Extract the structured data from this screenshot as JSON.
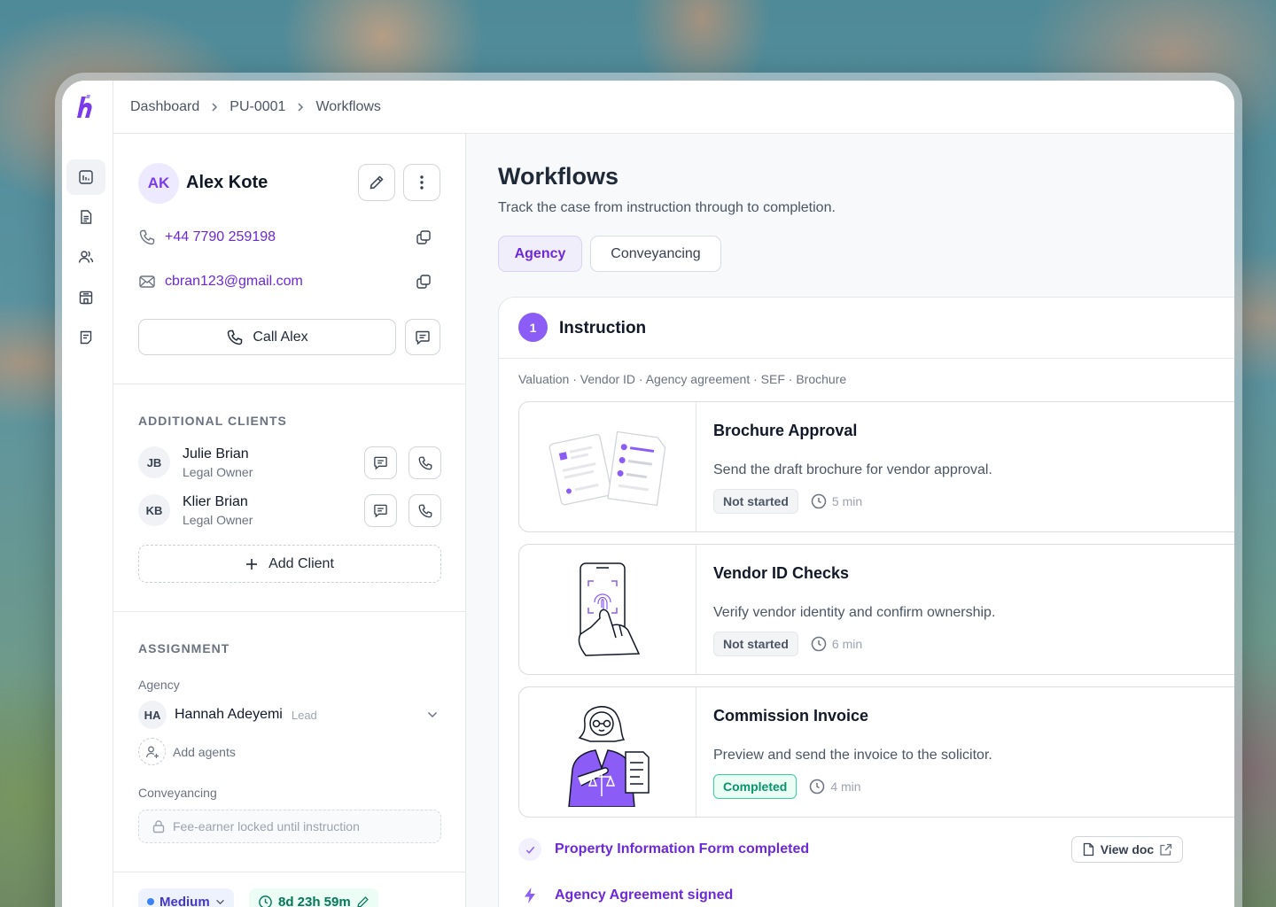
{
  "breadcrumb": [
    "Dashboard",
    "PU-0001",
    "Workflows"
  ],
  "nav": {
    "items": [
      {
        "icon": "reports-icon"
      },
      {
        "icon": "document-icon"
      },
      {
        "icon": "people-icon"
      },
      {
        "icon": "building-icon"
      },
      {
        "icon": "notes-icon"
      }
    ]
  },
  "client": {
    "initials": "AK",
    "name": "Alex Kote",
    "phone": "+44 7790 259198",
    "email": "cbran123@gmail.com",
    "call_label": "Call Alex"
  },
  "additional_clients": {
    "heading": "ADDITIONAL CLIENTS",
    "items": [
      {
        "initials": "JB",
        "name": "Julie Brian",
        "role": "Legal Owner"
      },
      {
        "initials": "KB",
        "name": "Klier Brian",
        "role": "Legal Owner"
      }
    ],
    "add_label": "Add Client"
  },
  "assignment": {
    "heading": "ASSIGNMENT",
    "agency_label": "Agency",
    "agent": {
      "initials": "HA",
      "name": "Hannah Adeyemi",
      "role": "Lead"
    },
    "add_agents_label": "Add agents",
    "conveyancing_label": "Conveyancing",
    "locked_text": "Fee-earner locked until instruction"
  },
  "footer_pills": {
    "priority": "Medium",
    "timer": "8d 23h 59m"
  },
  "main": {
    "title": "Workflows",
    "subtitle": "Track the case from instruction through to completion.",
    "tabs": [
      {
        "label": "Agency",
        "active": true
      },
      {
        "label": "Conveyancing",
        "active": false
      }
    ]
  },
  "step": {
    "number": "1",
    "title": "Instruction",
    "tags": "Valuation · Vendor ID · Agency agreement · SEF · Brochure",
    "tasks": [
      {
        "title": "Brochure Approval",
        "description": "Send the draft brochure for vendor approval.",
        "status": "Not started",
        "duration": "5 min"
      },
      {
        "title": "Vendor ID Checks",
        "description": "Verify vendor identity and confirm ownership.",
        "status": "Not started",
        "duration": "6 min"
      },
      {
        "title": "Commission Invoice",
        "description": "Preview and send the invoice to the solicitor.",
        "status": "Completed",
        "duration": "4 min"
      }
    ],
    "events": [
      {
        "label": "Property Information Form completed",
        "action": "View doc"
      },
      {
        "label": "Agency Agreement signed"
      }
    ]
  },
  "colors": {
    "accent": "#7c3aed",
    "accent_light": "#ede9fe",
    "success": "#059669"
  }
}
